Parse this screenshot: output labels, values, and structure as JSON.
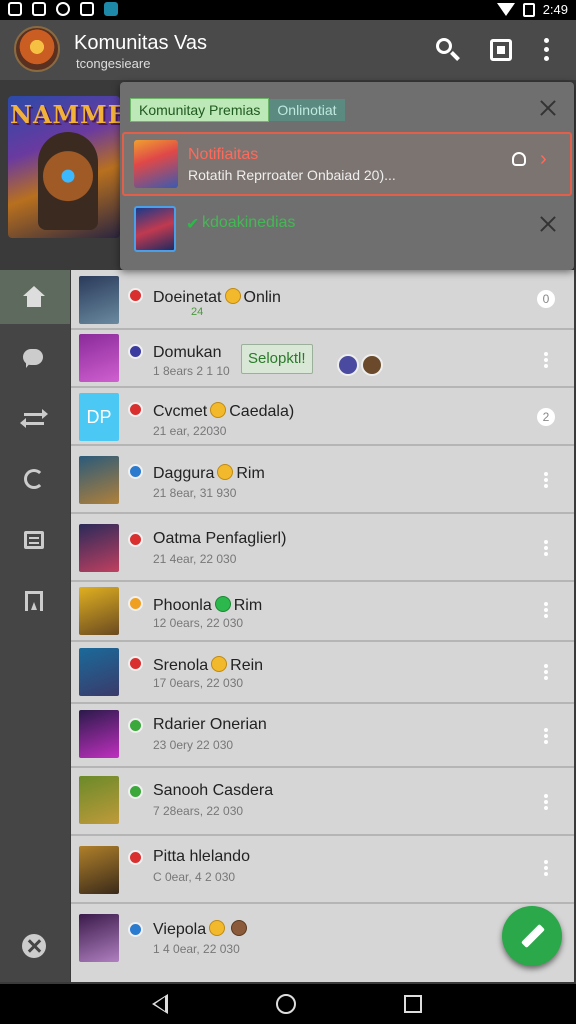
{
  "status_bar": {
    "time": "2:49"
  },
  "app_bar": {
    "title": "Komunitas Vas",
    "subtitle": "tcongesieare"
  },
  "hero": {
    "title": "NAMME"
  },
  "notifications": {
    "chip_primary": "Komunitay Premias",
    "chip_secondary": "Onlinotiat",
    "item1": {
      "title": "Notifiaitas",
      "text": "Rotatih Reprroater Onbaiad 20)..."
    },
    "item2": {
      "title": "kdoakinedias"
    }
  },
  "chats": [
    {
      "name": "Doeinetat",
      "suffix": "Onlin",
      "time": "",
      "sub": "24",
      "status_color": "#d92f2f",
      "thumb": [
        "#2a3a5a",
        "#6a8aa0"
      ],
      "action": "mark",
      "mark": "0"
    },
    {
      "name": "Domukan",
      "suffix": "",
      "time": "1 8ears 2 1 10",
      "select": "Selopktl!",
      "status_color": "#3a3aa0",
      "thumb": [
        "#8a2a9a",
        "#d060d0"
      ],
      "action": "menu"
    },
    {
      "name": "Cvcmet",
      "suffix": "Caedala)",
      "time": "21 ear, 22030",
      "status_color": "#d92f2f",
      "thumb_text": "DP",
      "action": "mark",
      "mark": "2"
    },
    {
      "name": "Daggura",
      "suffix": "Rim",
      "time": "21 8ear, 31 930",
      "status_color": "#2a7ad0",
      "thumb": [
        "#2a5a7a",
        "#b0803a"
      ],
      "action": "menu"
    },
    {
      "name": "Oatma Penfaglierl)",
      "suffix": "",
      "time": "21 4ear, 22 030",
      "status_color": "#d92f2f",
      "thumb": [
        "#2a2a5a",
        "#c04060"
      ],
      "action": "menu"
    },
    {
      "name": "Phoonla",
      "suffix": "Rim",
      "time": "12 0ears, 22 030",
      "status_color": "#f0a020",
      "thumb": [
        "#e0b020",
        "#6a4a20"
      ],
      "action": "menu"
    },
    {
      "name": "Srenola",
      "suffix": "Rein",
      "time": "17 0ears, 22 030",
      "status_color": "#d92f2f",
      "thumb": [
        "#1a6a9a",
        "#3a3a6a"
      ],
      "action": "menu"
    },
    {
      "name": "Rdarier Onerian",
      "suffix": "",
      "time": "23 0ery 22 030",
      "status_color": "#3aa83a",
      "thumb": [
        "#2a1a4a",
        "#c030c0"
      ],
      "action": "menu"
    },
    {
      "name": "Sanooh Casdera",
      "suffix": "",
      "time": "7 28ears, 22 030",
      "status_color": "#3aa83a",
      "thumb": [
        "#6a8a2a",
        "#c09a3a"
      ],
      "action": "menu"
    },
    {
      "name": "Pitta hlelando",
      "suffix": "",
      "time": "C 0ear, 4 2 030",
      "status_color": "#d92f2f",
      "thumb": [
        "#b0802a",
        "#3a2a1a"
      ],
      "action": "menu"
    },
    {
      "name": "Viepola",
      "suffix": "",
      "time": "1 4 0ear, 22 030",
      "status_color": "#2a7ad0",
      "thumb": [
        "#3a1a4a",
        "#b080c0"
      ],
      "action": "none"
    }
  ]
}
